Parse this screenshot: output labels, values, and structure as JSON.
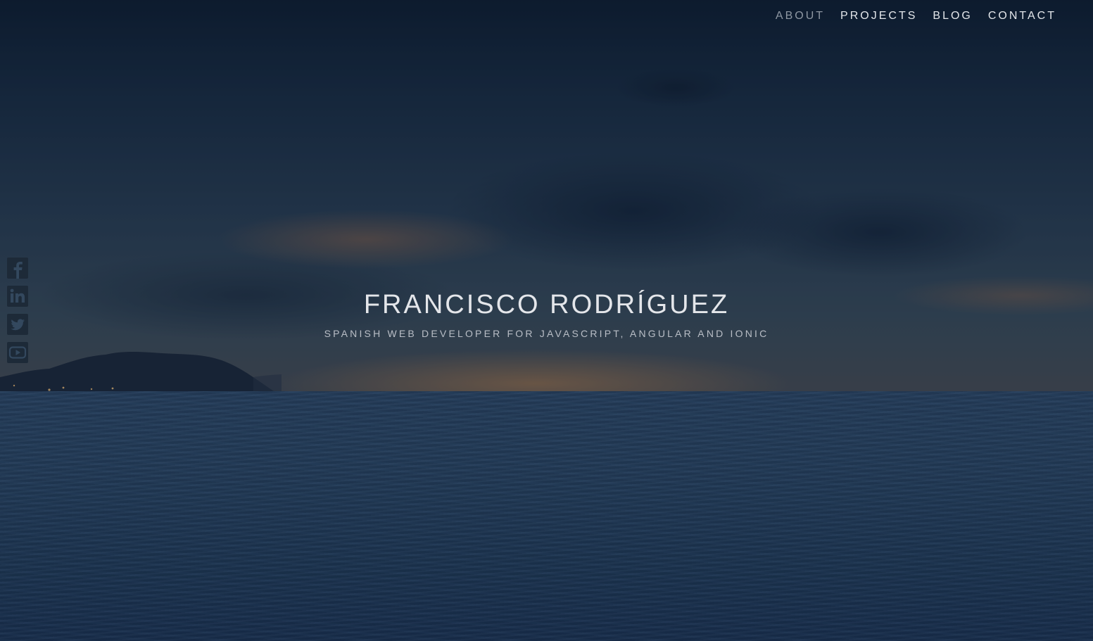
{
  "nav": {
    "items": [
      {
        "label": "ABOUT",
        "active": true
      },
      {
        "label": "PROJECTS",
        "active": false
      },
      {
        "label": "BLOG",
        "active": false
      },
      {
        "label": "CONTACT",
        "active": false
      }
    ]
  },
  "hero": {
    "title": "FRANCISCO RODRÍGUEZ",
    "subtitle": "SPANISH WEB DEVELOPER FOR JAVASCRIPT, ANGULAR AND IONIC"
  },
  "social": {
    "icons": [
      "facebook-icon",
      "linkedin-icon",
      "twitter-icon",
      "youtube-icon"
    ]
  },
  "colors": {
    "nav_text": "#e3e6ea",
    "nav_active": "#8e97a2",
    "icon_fill": "#1d2a38",
    "overlay": "#0c1c32"
  }
}
